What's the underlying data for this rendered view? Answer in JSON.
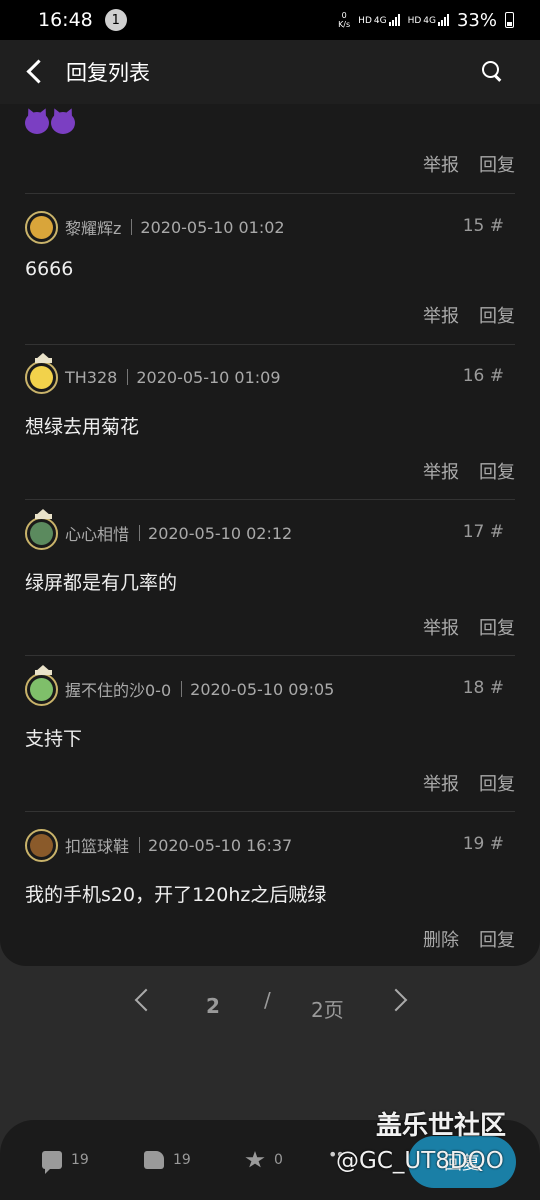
{
  "status_bar": {
    "time": "16:48",
    "notification_count": "1",
    "net_speed_value": "0",
    "net_speed_unit": "K/s",
    "sim1_label": "HD",
    "sim1_tech": "4G",
    "sim2_label": "HD",
    "sim2_tech": "4G",
    "battery": "33%"
  },
  "header": {
    "title": "回复列表"
  },
  "previous_item": {
    "actions": {
      "report": "举报",
      "reply": "回复"
    }
  },
  "replies": [
    {
      "user": "黎耀辉z",
      "datetime": "2020-05-10 01:02",
      "floor": "15 #",
      "content": "6666",
      "action_left": "举报",
      "action_right": "回复",
      "avatar_color": "#d9a53a"
    },
    {
      "user": "TH328",
      "datetime": "2020-05-10 01:09",
      "floor": "16 #",
      "content": "想绿去用菊花",
      "action_left": "举报",
      "action_right": "回复",
      "avatar_color": "#f2d24b"
    },
    {
      "user": "心心相惜",
      "datetime": "2020-05-10 02:12",
      "floor": "17 #",
      "content": "绿屏都是有几率的",
      "action_left": "举报",
      "action_right": "回复",
      "avatar_color": "#5b8a5e"
    },
    {
      "user": "握不住的沙0-0",
      "datetime": "2020-05-10 09:05",
      "floor": "18 #",
      "content": "支持下",
      "action_left": "举报",
      "action_right": "回复",
      "avatar_color": "#7fbf6a"
    },
    {
      "user": "扣篮球鞋",
      "datetime": "2020-05-10 16:37",
      "floor": "19 #",
      "content": "我的手机s20，开了120hz之后贼绿",
      "action_left": "删除",
      "action_right": "回复",
      "avatar_color": "#8a5a2a"
    }
  ],
  "pagination": {
    "current": "2",
    "separator": "/",
    "total": "2页"
  },
  "bottom_bar": {
    "comments": "19",
    "likes": "19",
    "favorites": "0",
    "reply_button": "回复"
  },
  "watermark": {
    "line1": "盖乐世社区",
    "line2": "@GC_UT8DQO"
  }
}
